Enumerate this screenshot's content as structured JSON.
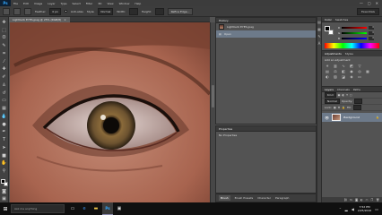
{
  "menubar": {
    "logo": "Ps",
    "items": [
      "File",
      "Edit",
      "Image",
      "Layer",
      "Type",
      "Select",
      "Filter",
      "3D",
      "View",
      "Window",
      "Help"
    ],
    "window_controls": [
      "—",
      "▢",
      "✕"
    ]
  },
  "options": {
    "feather_label": "Feather:",
    "feather_value": "0 px",
    "antialias_label": "Anti-alias",
    "style_label": "Style:",
    "style_value": "Normal",
    "width_label": "Width:",
    "height_label": "Height:",
    "refine_label": "Refine Edge...",
    "workspace": "Essentials"
  },
  "document": {
    "tab_title": "Lightbulb EYES.jpeg @ 25% (RGB/8)",
    "tab_close": "×"
  },
  "history": {
    "header": "History",
    "snapshot_name": "Lightbulb EYES.jpeg",
    "state": "Open"
  },
  "properties": {
    "header": "Properties",
    "text": "No Properties",
    "tabs": [
      "Brush",
      "Brush Presets",
      "Character",
      "Paragraph"
    ]
  },
  "color_panel": {
    "tabs": [
      "Color",
      "Swatches"
    ],
    "channels": [
      {
        "label": "R",
        "value": "0"
      },
      {
        "label": "G",
        "value": "0"
      },
      {
        "label": "B",
        "value": "0"
      }
    ]
  },
  "adjustments": {
    "tabs": [
      "Adjustments",
      "Styles"
    ],
    "label": "Add an adjustment"
  },
  "layers": {
    "tabs": [
      "Layers",
      "Channels",
      "Paths"
    ],
    "kind_label": "Kind",
    "mode": "Normal",
    "opacity_label": "Opacity:",
    "lock_label": "Lock:",
    "fill_label": "Fill:",
    "layer_name": "Background",
    "layer_lock": "🔒",
    "footer_icons": [
      "link-icon",
      "fx-icon",
      "mask-icon",
      "adjust-icon",
      "folder-icon",
      "new-layer-icon",
      "trash-icon"
    ]
  },
  "taskbar": {
    "search_placeholder": "Ask me anything",
    "time": "7:52 PM",
    "date": "2/25/2016"
  },
  "colors": {
    "accent": "#31a8ff",
    "selection": "#6d7a8a"
  }
}
